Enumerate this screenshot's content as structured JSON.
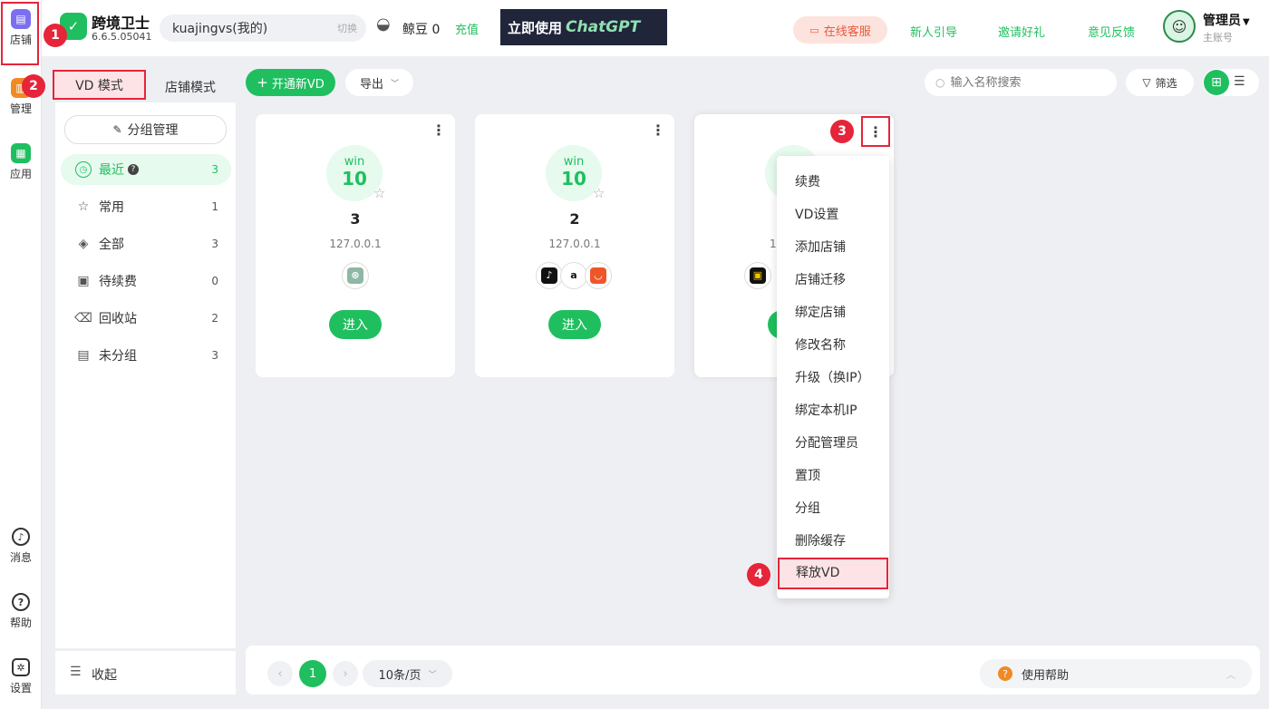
{
  "brand": {
    "name": "跨境卫士",
    "version": "6.6.5.05041"
  },
  "account": {
    "name": "kuajingvs(我的)",
    "switch_label": "切换"
  },
  "beans": {
    "label": "鲸豆 0",
    "recharge": "充值"
  },
  "banner": {
    "prefix": "立即使用",
    "product": "ChatGPT"
  },
  "header": {
    "service": "在线客服",
    "guide": "新人引导",
    "invite": "邀请好礼",
    "feedback": "意见反馈",
    "user_name": "管理员",
    "user_role": "主账号"
  },
  "rail": {
    "items": [
      {
        "label": "店铺",
        "icon": "shop-icon"
      },
      {
        "label": "管理",
        "icon": "manage-icon"
      },
      {
        "label": "应用",
        "icon": "apps-icon"
      }
    ],
    "bottom": [
      {
        "label": "消息",
        "icon": "bell-icon"
      },
      {
        "label": "帮助",
        "icon": "help-icon"
      },
      {
        "label": "设置",
        "icon": "gear-icon"
      }
    ]
  },
  "modes": {
    "vd": "VD 模式",
    "shop": "店铺模式"
  },
  "toolbar": {
    "new_vd": "开通新VD",
    "export": "导出",
    "search_placeholder": "输入名称搜索",
    "filter": "筛选"
  },
  "sidebar": {
    "group_manage": "分组管理",
    "items": [
      {
        "label": "最近",
        "count": "3"
      },
      {
        "label": "常用",
        "count": "1"
      },
      {
        "label": "全部",
        "count": "3"
      },
      {
        "label": "待续费",
        "count": "0"
      },
      {
        "label": "回收站",
        "count": "2"
      },
      {
        "label": "未分组",
        "count": "3"
      }
    ],
    "collapse": "收起"
  },
  "cards": [
    {
      "os_top": "win",
      "os_num": "10",
      "name": "3",
      "ip": "127.0.0.1",
      "enter": "进入",
      "shops": [
        "chatgpt-icon"
      ]
    },
    {
      "os_top": "win",
      "os_num": "10",
      "name": "2",
      "ip": "127.0.0.1",
      "enter": "进入",
      "shops": [
        "tiktok-icon",
        "amazon-icon",
        "aliexpress-icon"
      ]
    },
    {
      "ip_partial": "1",
      "shops": [
        "shopee-icon"
      ]
    }
  ],
  "context_menu": [
    "续费",
    "VD设置",
    "添加店铺",
    "店铺迁移",
    "绑定店铺",
    "修改名称",
    "升级（换IP）",
    "绑定本机IP",
    "分配管理员",
    "置顶",
    "分组",
    "删除缓存",
    "释放VD"
  ],
  "pagination": {
    "current": "1",
    "page_size": "10条/页"
  },
  "help": {
    "label": "使用帮助"
  },
  "markers": [
    "1",
    "2",
    "3",
    "4"
  ],
  "colors": {
    "accent": "#1fbf5f",
    "highlight": "#e6243a"
  }
}
